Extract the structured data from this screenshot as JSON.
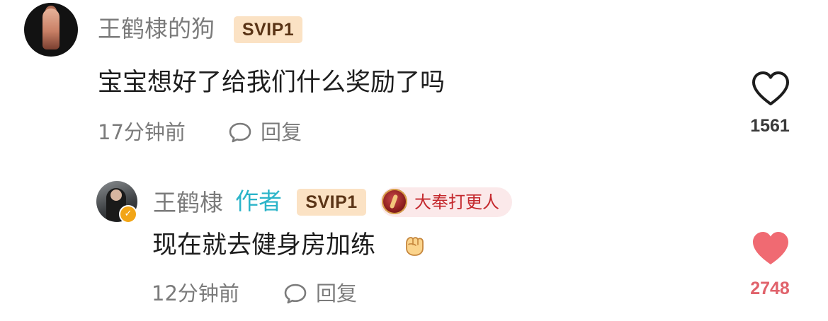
{
  "comment": {
    "username": "王鹤棣的狗",
    "badge": "SVIP1",
    "text": "宝宝想好了给我们什么奖励了吗",
    "timestamp": "17分钟前",
    "reply_label": "回复",
    "likes": "1561",
    "liked": false
  },
  "reply": {
    "username": "王鹤棣",
    "author_tag": "作者",
    "badge": "SVIP1",
    "show_badge": "大奉打更人",
    "verified_mark": "✓",
    "text": "现在就去健身房加练",
    "emoji": "flexed-fist-emoji",
    "timestamp": "12分钟前",
    "reply_label": "回复",
    "likes": "2748",
    "liked": true
  },
  "colors": {
    "author_tag": "#2bb4c9",
    "svip_bg": "#fbe2c4",
    "liked": "#f06a72",
    "like_count_active": "#e0626b",
    "secondary_text": "#7b7b7b"
  },
  "icons": {
    "like_empty": "heart-outline-icon",
    "like_filled": "heart-filled-icon",
    "reply": "speech-bubble-icon",
    "verified": "verified-check-icon"
  }
}
